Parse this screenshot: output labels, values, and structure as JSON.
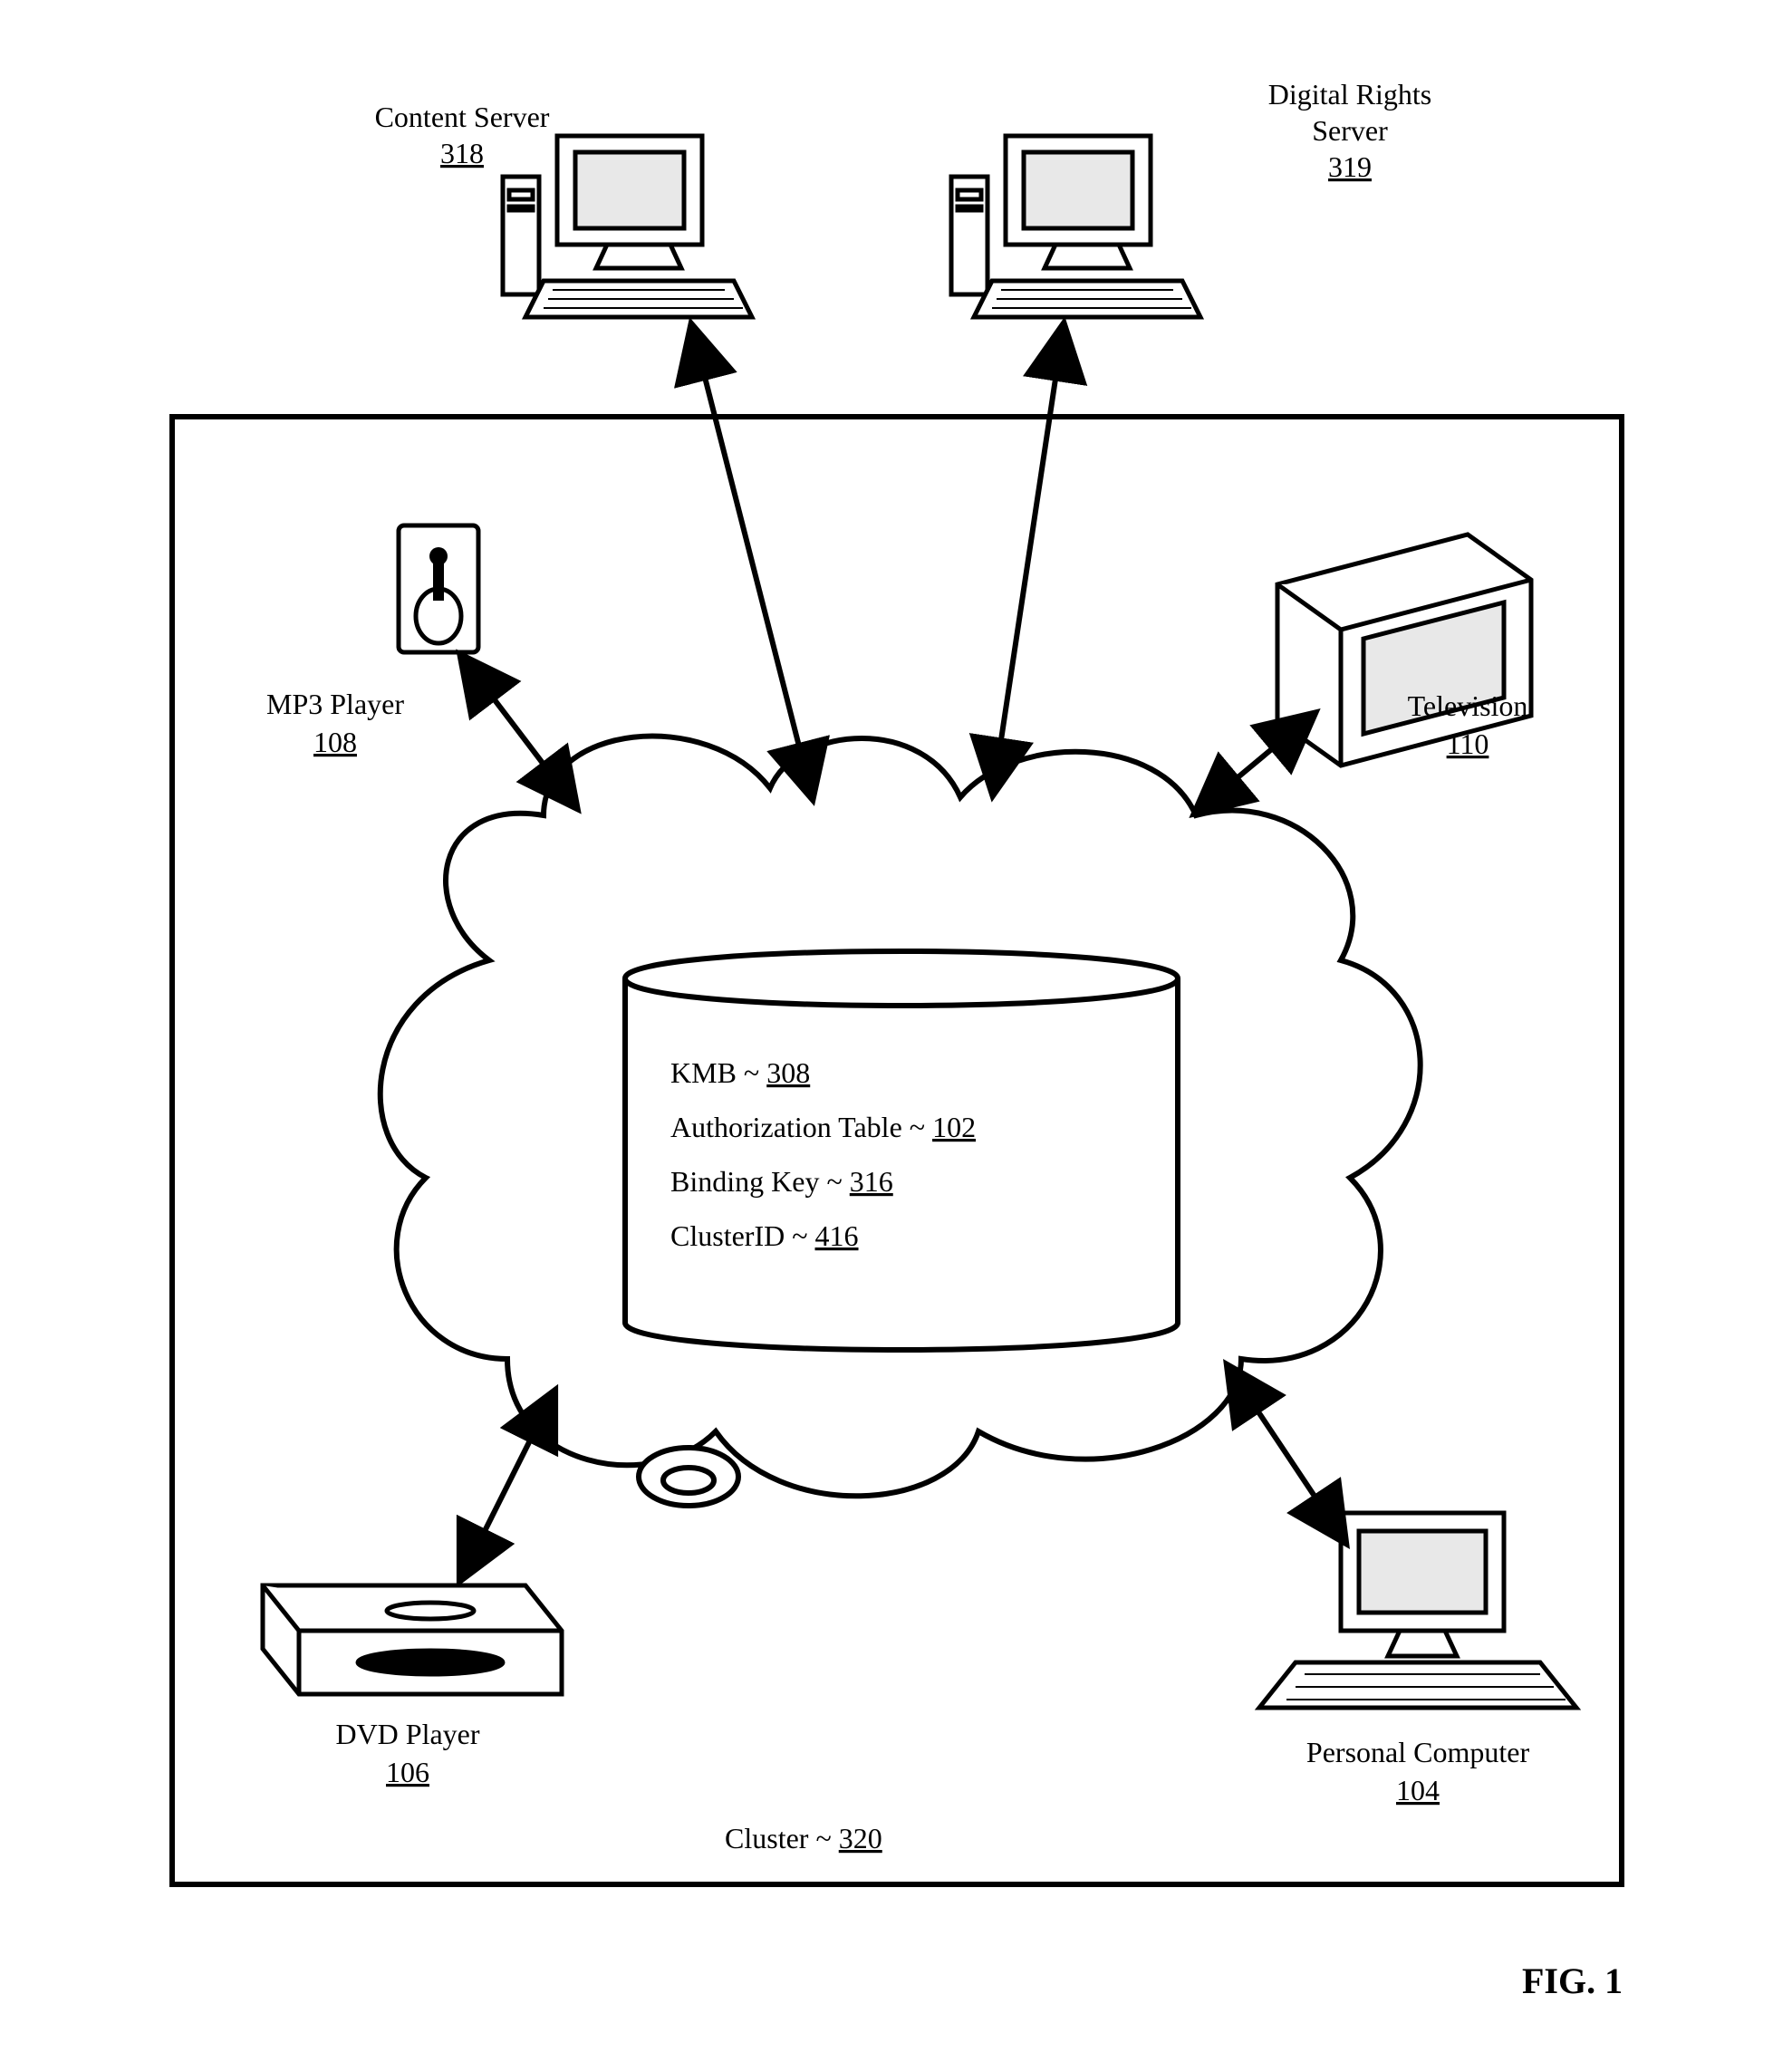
{
  "figure": "FIG. 1",
  "servers": {
    "content": {
      "label": "Content Server",
      "ref": "318"
    },
    "drs": {
      "label1": "Digital Rights",
      "label2": "Server",
      "ref": "319"
    }
  },
  "devices": {
    "mp3": {
      "label": "MP3 Player",
      "ref": "108"
    },
    "tv": {
      "label": "Television",
      "ref": "110"
    },
    "dvd": {
      "label": "DVD Player",
      "ref": "106"
    },
    "pc": {
      "label": "Personal Computer",
      "ref": "104"
    }
  },
  "db": {
    "kmb": {
      "label": "KMB ~ ",
      "ref": "308"
    },
    "auth": {
      "label": "Authorization Table ~ ",
      "ref": "102"
    },
    "binding": {
      "label": "Binding Key ~ ",
      "ref": "316"
    },
    "cluster": {
      "label": "ClusterID ~ ",
      "ref": "416"
    }
  },
  "cluster": {
    "label": "Cluster ~ ",
    "ref": "320"
  }
}
